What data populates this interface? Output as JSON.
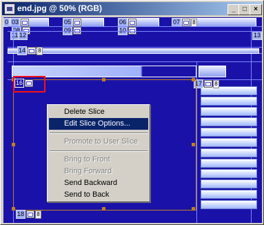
{
  "window": {
    "title": "end.jpg @ 50% (RGB)",
    "minimize_glyph": "_",
    "maximize_glyph": "□",
    "close_glyph": "×"
  },
  "slices": {
    "s03": "03",
    "s04": "04",
    "s05": "05",
    "s06": "06",
    "s07": "07",
    "s08": "08",
    "s09": "09",
    "s10": "10",
    "s11": "11",
    "s12": "12",
    "s13": "13",
    "s14": "14",
    "s16": "16",
    "s17": "17",
    "s18": "18",
    "zero": "0",
    "indicator": "8"
  },
  "context_menu": {
    "items": [
      {
        "label": "Delete Slice",
        "state": "enabled"
      },
      {
        "label": "Edit Slice Options...",
        "state": "highlighted"
      },
      {
        "label": "Promote to User Slice",
        "state": "disabled"
      },
      {
        "label": "Bring to Front",
        "state": "disabled"
      },
      {
        "label": "Bring Forward",
        "state": "disabled"
      },
      {
        "label": "Send Backward",
        "state": "enabled"
      },
      {
        "label": "Send to Back",
        "state": "enabled"
      }
    ]
  },
  "colors": {
    "canvas": "#1a12a8",
    "titlebar_start": "#0a246a",
    "titlebar_end": "#a6caf0",
    "highlight": "#0a246a",
    "selection_outline": "#ff1010",
    "slice_handles": "#c08020"
  }
}
